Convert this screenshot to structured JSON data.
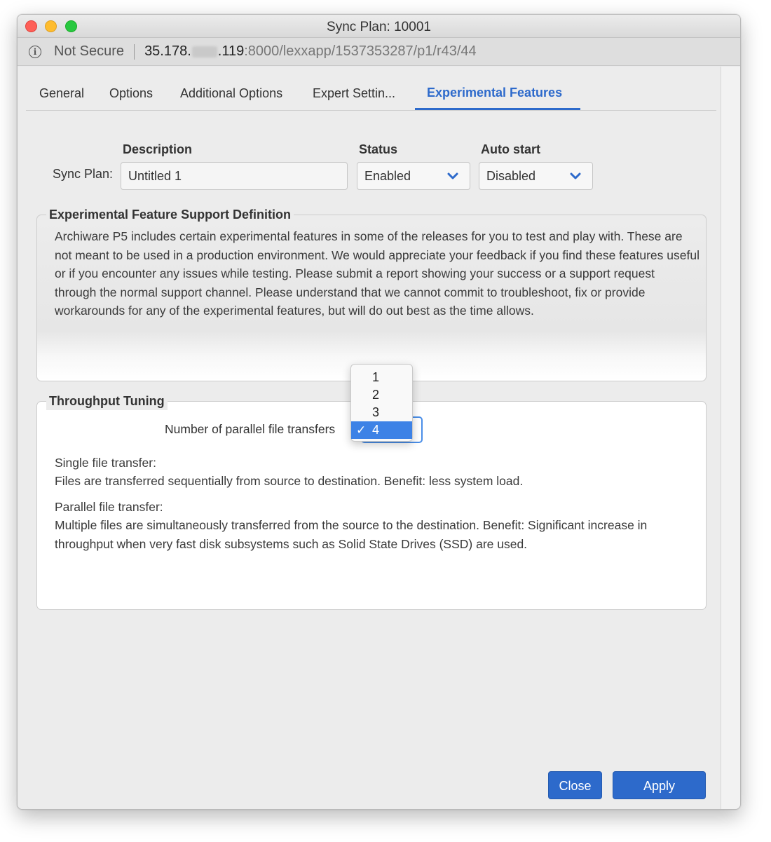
{
  "window": {
    "title": "Sync Plan: 10001"
  },
  "address": {
    "not_secure": "Not Secure",
    "host_start": "35.178.",
    "host_end": ".119",
    "path": ":8000/lexxapp/1537353287/p1/r43/44"
  },
  "tabs": [
    {
      "label": "General"
    },
    {
      "label": "Options"
    },
    {
      "label": "Additional Options"
    },
    {
      "label": "Expert Settin..."
    },
    {
      "label": "Experimental Features"
    }
  ],
  "form": {
    "description_header": "Description",
    "status_header": "Status",
    "autostart_header": "Auto start",
    "sync_plan_label": "Sync Plan:",
    "description_value": "Untitled 1",
    "status_value": "Enabled",
    "autostart_value": "Disabled"
  },
  "definition": {
    "legend": "Experimental Feature Support Definition",
    "text": "Archiware P5 includes certain experimental features in some of the releases for you to test and play with. These are not meant to be used in a production environment. We would appreciate your feedback if you find these features useful or if you encounter any issues while testing. Please submit a report showing your success or a support request through the normal support channel. Please understand that we cannot commit to troubleshoot, fix or provide workarounds for any of the experimental features, but will do out best as the time allows."
  },
  "throughput": {
    "legend": "Throughput Tuning",
    "parallel_label": "Number of parallel file transfers",
    "options": [
      "1",
      "2",
      "3",
      "4"
    ],
    "selected": "4",
    "check": "✓",
    "single_title": "Single file transfer:",
    "single_desc": "Files are transferred sequentially from source to destination. Benefit: less system load.",
    "parallel_title": "Parallel file transfer:",
    "parallel_desc": "Multiple files are simultaneously transferred from the source to the destination. Benefit: Significant increase in throughput when very fast disk subsystems such as Solid State Drives (SSD) are used."
  },
  "buttons": {
    "close": "Close",
    "apply": "Apply"
  },
  "colors": {
    "accent": "#2d6acb",
    "highlight": "#3d82e6"
  }
}
